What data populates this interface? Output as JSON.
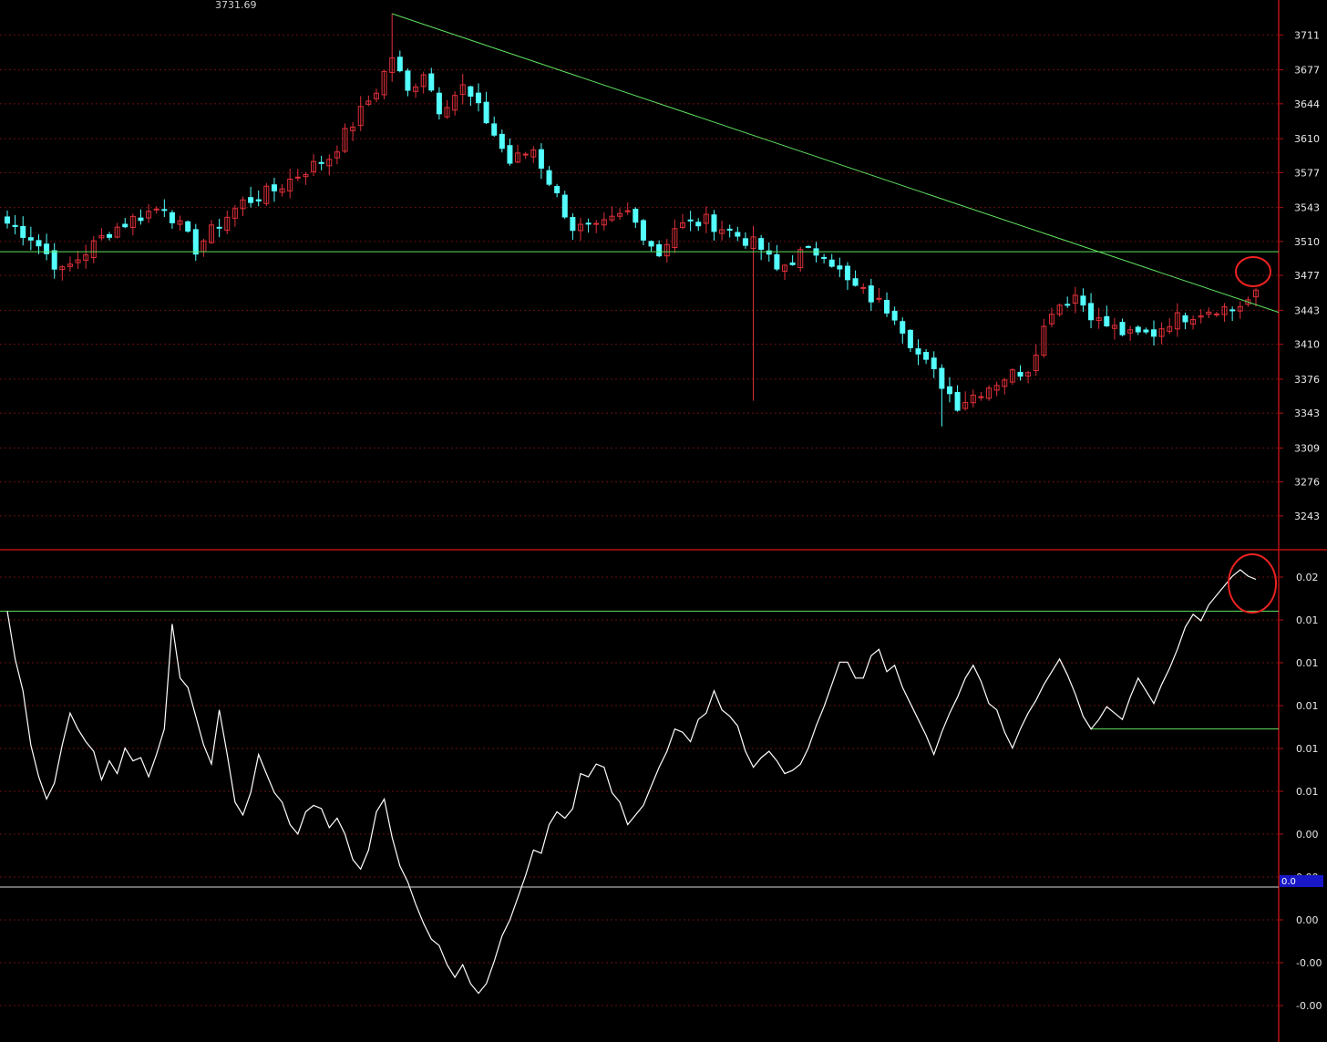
{
  "colors": {
    "background": "#000000",
    "up": "#e0303a",
    "down": "#54ffff",
    "frame": "#b81010",
    "grid": "#6a1010",
    "trendline": "#5ee05e",
    "indicator_line": "#ffffff",
    "zero_line": "#d8d8d8",
    "highlight": "#ee2222",
    "marker_bg": "#1818c8"
  },
  "chart_data": [
    {
      "type": "candlestick",
      "title": "",
      "peak_annotation": "3731.69",
      "y_ticks": [
        "3711",
        "3677",
        "3644",
        "3610",
        "3577",
        "3543",
        "3510",
        "3477",
        "3443",
        "3410",
        "3376",
        "3343",
        "3309",
        "3276",
        "3243"
      ],
      "ylim": [
        3210,
        3745
      ],
      "bar_count": 160,
      "anchors": [
        [
          0,
          3528
        ],
        [
          3,
          3515
        ],
        [
          5,
          3498
        ],
        [
          7,
          3480
        ],
        [
          10,
          3500
        ],
        [
          13,
          3520
        ],
        [
          16,
          3532
        ],
        [
          20,
          3545
        ],
        [
          24,
          3503
        ],
        [
          27,
          3528
        ],
        [
          30,
          3548
        ],
        [
          34,
          3560
        ],
        [
          38,
          3580
        ],
        [
          41,
          3592
        ],
        [
          44,
          3625
        ],
        [
          47,
          3658
        ],
        [
          49,
          3690
        ],
        [
          51,
          3655
        ],
        [
          53,
          3676
        ],
        [
          55,
          3640
        ],
        [
          58,
          3660
        ],
        [
          61,
          3628
        ],
        [
          64,
          3587
        ],
        [
          67,
          3600
        ],
        [
          70,
          3554
        ],
        [
          72,
          3524
        ],
        [
          75,
          3521
        ],
        [
          79,
          3538
        ],
        [
          83,
          3498
        ],
        [
          85,
          3524
        ],
        [
          89,
          3530
        ],
        [
          92,
          3520
        ],
        [
          94,
          3512
        ],
        [
          96,
          3503
        ],
        [
          98,
          3482
        ],
        [
          101,
          3498
        ],
        [
          104,
          3501
        ],
        [
          107,
          3470
        ],
        [
          110,
          3455
        ],
        [
          113,
          3440
        ],
        [
          116,
          3400
        ],
        [
          119,
          3372
        ],
        [
          121,
          3352
        ],
        [
          124,
          3365
        ],
        [
          127,
          3378
        ],
        [
          130,
          3387
        ],
        [
          133,
          3445
        ],
        [
          136,
          3458
        ],
        [
          139,
          3432
        ],
        [
          143,
          3418
        ],
        [
          146,
          3421
        ],
        [
          148,
          3433
        ],
        [
          151,
          3440
        ],
        [
          154,
          3446
        ],
        [
          156,
          3444
        ],
        [
          159,
          3457
        ]
      ],
      "segments": [
        [
          0,
          3540,
          1,
          3525
        ],
        [
          2,
          3510,
          9,
          3495
        ],
        [
          10,
          3485,
          20,
          3540
        ],
        [
          21,
          3540,
          24,
          3500
        ],
        [
          25,
          3495,
          31,
          3545
        ],
        [
          32,
          3555,
          37,
          3570
        ],
        [
          38,
          3575,
          44,
          3620
        ],
        [
          45,
          3625,
          48,
          3665
        ],
        [
          49,
          3655,
          52,
          3656
        ],
        [
          53,
          3650,
          55,
          3645
        ],
        [
          56,
          3640,
          59,
          3611
        ],
        [
          60,
          3600,
          67,
          3572
        ],
        [
          68,
          3560,
          71,
          3534
        ],
        [
          72,
          3530,
          75,
          3504
        ],
        [
          76,
          3498,
          79,
          3516
        ],
        [
          80,
          3520,
          81,
          3495
        ],
        [
          82,
          3490,
          83,
          3470
        ],
        [
          84,
          3465,
          85,
          3460
        ],
        [
          86,
          3455,
          87,
          3450
        ],
        [
          88,
          3445,
          89,
          3440
        ],
        [
          90,
          3435,
          92,
          3395
        ],
        [
          93,
          3390,
          95,
          3370
        ],
        [
          96,
          3367,
          98,
          3369
        ],
        [
          99,
          3372,
          101,
          3409
        ],
        [
          102,
          3413,
          103,
          3411
        ],
        [
          104,
          3410,
          107,
          3427
        ],
        [
          108,
          3431,
          109,
          3426
        ],
        [
          110,
          3423,
          114,
          3445
        ],
        [
          115,
          3449,
          117,
          3460
        ],
        [
          118,
          3455,
          119,
          3445
        ],
        [
          120,
          3440,
          123,
          3414
        ],
        [
          124,
          3410,
          126,
          3418
        ],
        [
          127,
          3422,
          129,
          3437
        ],
        [
          130,
          3441,
          132,
          3440
        ],
        [
          133,
          3436,
          136,
          3427
        ],
        [
          137,
          3423,
          139,
          3419
        ],
        [
          140,
          3416,
          142,
          3430
        ],
        [
          143,
          3433,
          146,
          3434
        ],
        [
          147,
          3433,
          149,
          3442
        ],
        [
          150,
          3445,
          153,
          3437
        ],
        [
          154,
          3435,
          156,
          3438
        ],
        [
          157,
          3440,
          159,
          3455
        ]
      ]
    },
    {
      "type": "line",
      "title": "",
      "y_ticks": [
        "0.02",
        "0.01",
        "0.01",
        "0.01",
        "0.01",
        "0.01",
        "0.00",
        "0.00",
        "0.00",
        "-0.00",
        "-0.00"
      ],
      "ylim": [
        -7.6,
        7.0
      ],
      "value_marker": "0.0",
      "values": [
        5.7,
        4.2,
        3.2,
        1.5,
        0.5,
        -0.2,
        0.3,
        1.5,
        2.5,
        2.0,
        1.6,
        1.3,
        0.4,
        1.0,
        0.6,
        1.4,
        1.0,
        1.1,
        0.5,
        1.2,
        2.0,
        5.3,
        3.6,
        3.3,
        2.4,
        1.5,
        0.9,
        2.6,
        1.2,
        -0.3,
        -0.7,
        0.0,
        1.2,
        0.6,
        0.0,
        -0.3,
        -1.0,
        -1.3,
        -0.6,
        -0.4,
        -0.5,
        -1.1,
        -0.8,
        -1.3,
        -2.1,
        -2.4,
        -1.8,
        -0.6,
        -0.2,
        -1.4,
        -2.3,
        -2.8,
        -3.5,
        -4.1,
        -4.6,
        -4.8,
        -5.4,
        -5.8,
        -5.4,
        -6.0,
        -6.3,
        -6.0,
        -5.3,
        -4.5,
        -4.0,
        -3.3,
        -2.6,
        -1.8,
        -1.9,
        -1.0,
        -0.6,
        -0.8,
        -0.5,
        0.6,
        0.5,
        0.9,
        0.8,
        0.0,
        -0.3,
        -1.0,
        -0.7,
        -0.4,
        0.2,
        0.8,
        1.3,
        2.0,
        1.9,
        1.6,
        2.3,
        2.5,
        3.2,
        2.6,
        2.4,
        2.1,
        1.3,
        0.8,
        1.1,
        1.3,
        1.0,
        0.6,
        0.7,
        0.9,
        1.4,
        2.1,
        2.7,
        3.4,
        4.1,
        4.1,
        3.6,
        3.6,
        4.3,
        4.5,
        3.8,
        4.0,
        3.3,
        2.8,
        2.3,
        1.8,
        1.2,
        1.9,
        2.5,
        3.0,
        3.6,
        4.0,
        3.5,
        2.8,
        2.6,
        1.9,
        1.4,
        2.0,
        2.5,
        2.9,
        3.4,
        3.8,
        4.2,
        3.7,
        3.1,
        2.4,
        2.0,
        2.3,
        2.7,
        2.5,
        2.3,
        3.0,
        3.6,
        3.2,
        2.8,
        3.4,
        3.9,
        4.5,
        5.2,
        5.6,
        5.4,
        5.9,
        6.2,
        6.5,
        6.8,
        7.0,
        6.8,
        6.7
      ]
    }
  ]
}
